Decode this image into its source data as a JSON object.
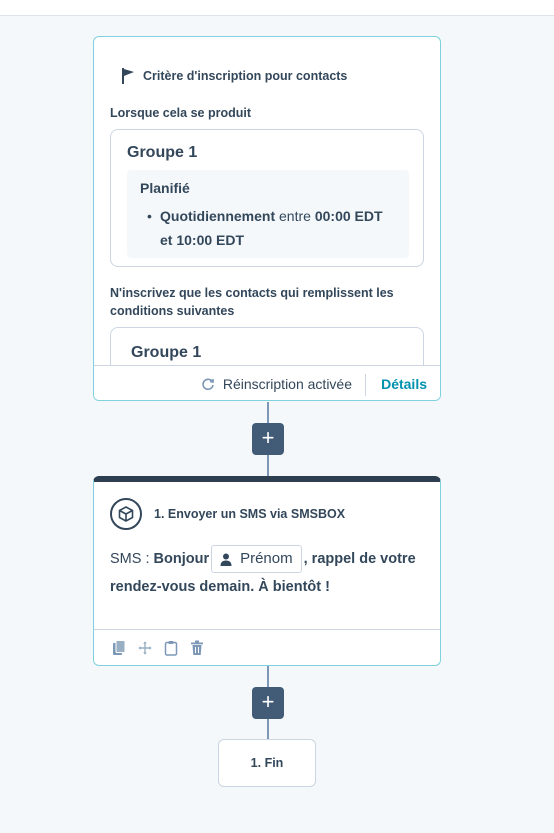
{
  "trigger": {
    "title": "Critère d'inscription pour contacts",
    "when_label": "Lorsque cela se produit",
    "group1_title": "Groupe 1",
    "schedule_title": "Planifié",
    "schedule_frequency": "Quotidiennement",
    "schedule_between": "entre",
    "schedule_start": "00:00 EDT",
    "schedule_and": "et",
    "schedule_end": "10:00 EDT",
    "conditions_label": "N'inscrivez que les contacts qui remplissent les conditions suivantes",
    "group2_title": "Groupe 1",
    "reenrollment": "Réinscription activée",
    "details_link": "Détails"
  },
  "add_button": "+",
  "action": {
    "title": "1. Envoyer un SMS via SMSBOX",
    "sms_prefix": "SMS :",
    "sms_greeting": "Bonjour",
    "token_label": "Prénom",
    "sms_rest": ", rappel de votre rendez-vous demain. À bientôt !"
  },
  "end_node": "1. Fin",
  "icons": {
    "flag": "flag-icon",
    "sync": "sync-icon",
    "cube": "cube-icon",
    "person": "person-icon",
    "clone": "clone-icon",
    "move": "move-icon",
    "clipboard": "clipboard-icon",
    "delete": "trash-icon"
  },
  "colors": {
    "accent": "#0091ae",
    "card_border": "#7fd1de",
    "dark": "#2d3e50",
    "button": "#425b76"
  }
}
